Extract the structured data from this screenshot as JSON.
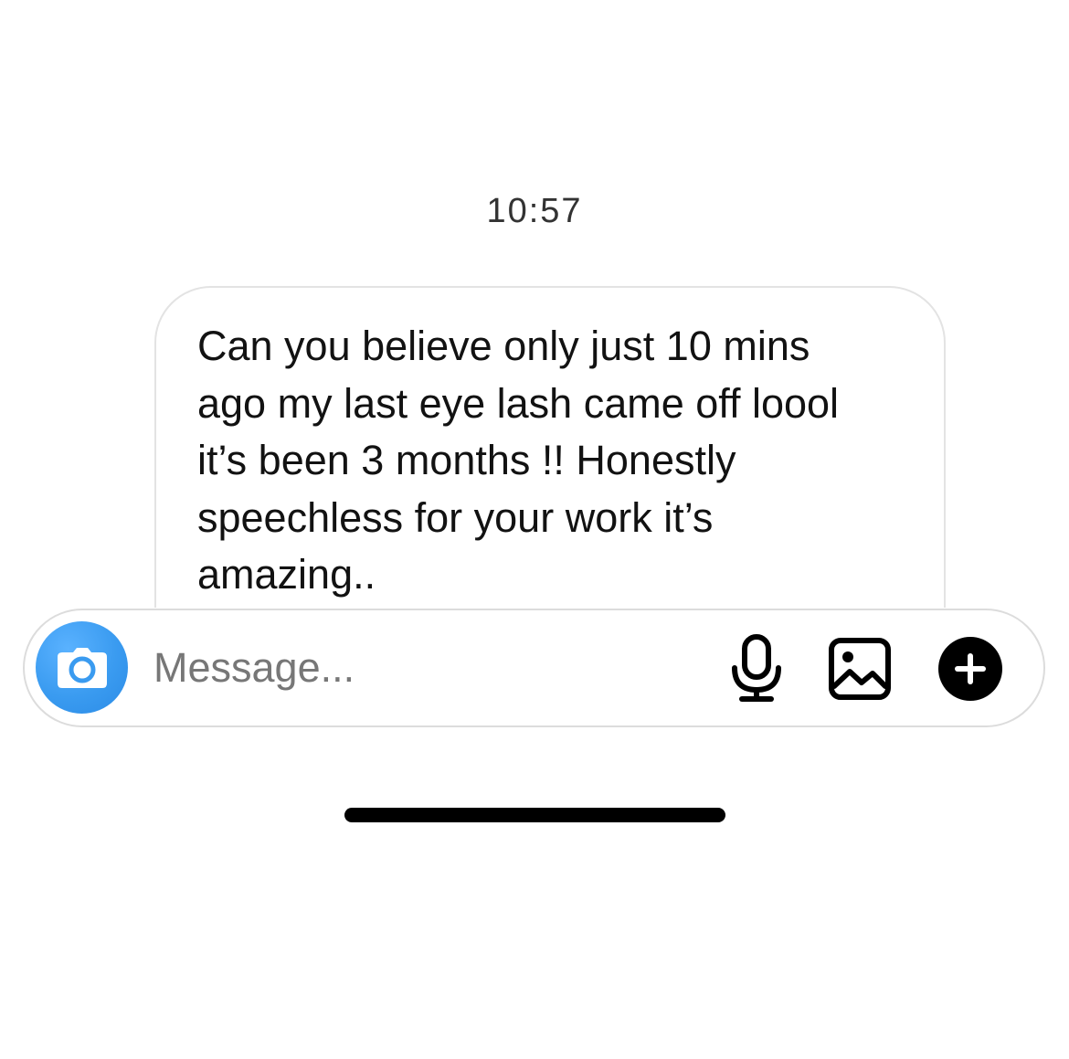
{
  "thread": {
    "timestamp": "10:57",
    "messages": [
      {
        "text": "Can you believe only just 10 mins\nago my last eye lash came off loool\nit’s been 3 months !! Honestly\nspeechless for your work it’s\namazing.."
      }
    ]
  },
  "composer": {
    "placeholder": "Message...",
    "value": "",
    "camera_icon": "camera-icon",
    "mic_icon": "microphone-icon",
    "gallery_icon": "gallery-icon",
    "plus_icon": "plus-icon"
  },
  "colors": {
    "camera_button": "#3a9bf0",
    "bubble_border": "#e3e3e3",
    "composer_border": "#dcdcdc",
    "plus_button": "#000000",
    "home_indicator": "#000000"
  }
}
